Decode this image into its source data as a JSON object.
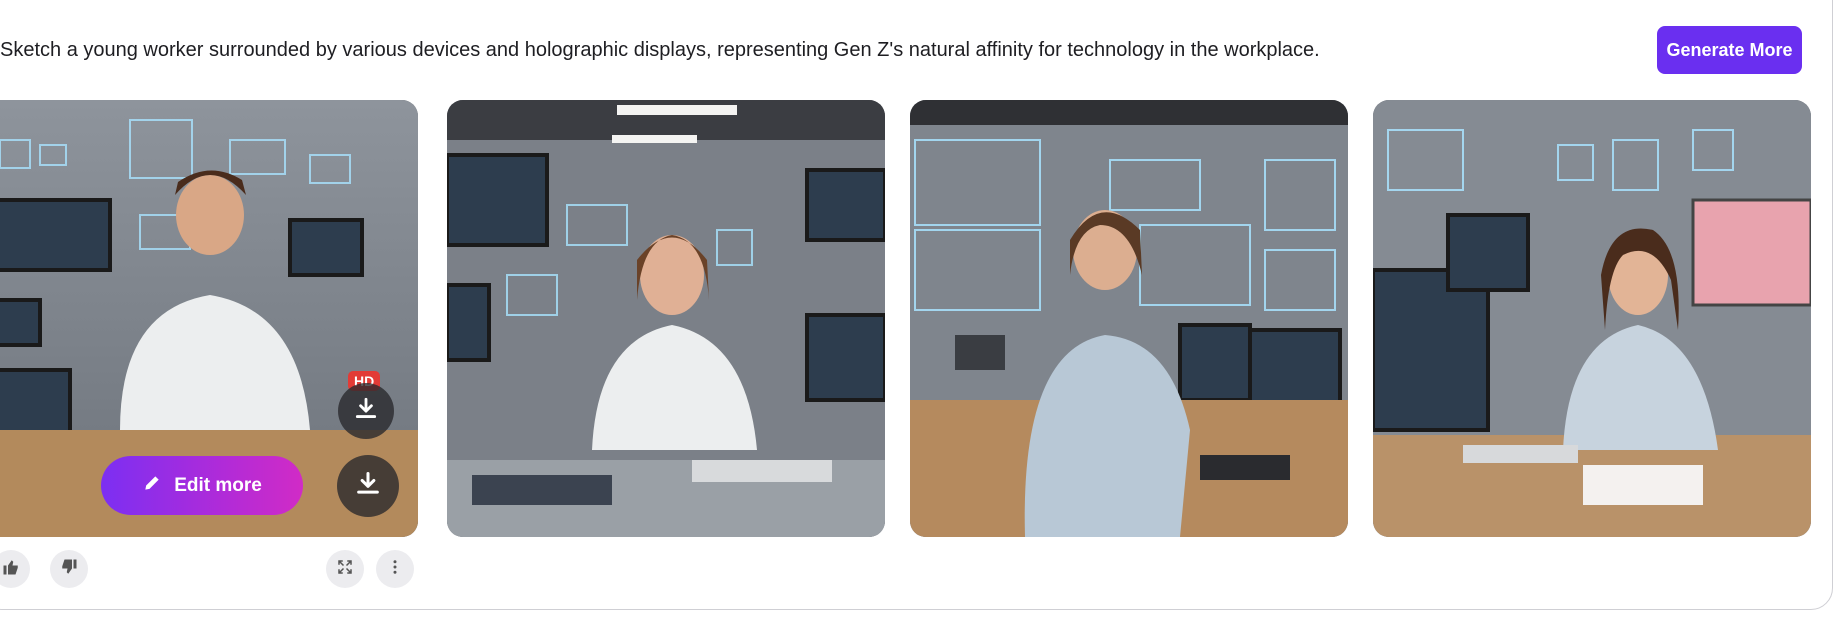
{
  "prompt": {
    "text": "Sketch a young worker surrounded by various devices and holographic displays, representing Gen Z's natural affinity for technology in the workplace."
  },
  "actions": {
    "generate_more_label": "Generate More"
  },
  "image_tools": {
    "edit_more_label": "Edit more",
    "hd_badge": "HD",
    "icons": [
      "pencil-icon",
      "download-icon",
      "thumbs-up-icon",
      "thumbs-down-icon",
      "expand-icon",
      "more-vertical-icon"
    ]
  },
  "images": [
    {
      "subject": "young man in white shirt at desk with holographic displays"
    },
    {
      "subject": "young woman in white shirt at desk with tablet and keyboard"
    },
    {
      "subject": "young woman with ponytail typing at computer with holographic displays"
    },
    {
      "subject": "young woman with glasses at desk with monitors and pink display"
    }
  ],
  "colors": {
    "accent": "#6a2ff0",
    "hd_badge": "#e23b36"
  }
}
